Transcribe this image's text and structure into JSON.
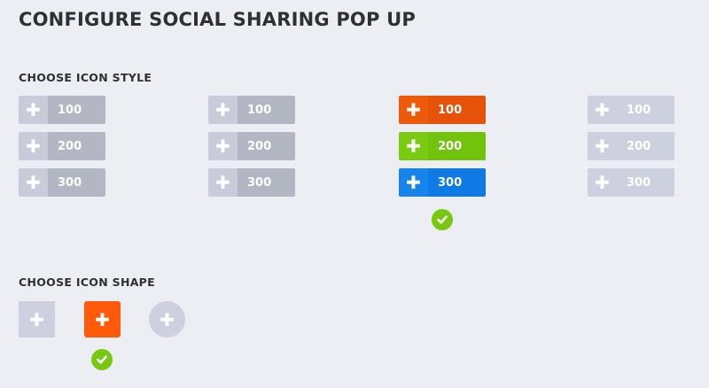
{
  "page": {
    "title": "CONFIGURE SOCIAL SHARING POP UP"
  },
  "icon_style": {
    "heading": "CHOOSE ICON STYLE",
    "plus_glyph": "✚",
    "columns": [
      {
        "variant": "gray",
        "buttons": [
          "100",
          "200",
          "300"
        ],
        "selected": false
      },
      {
        "variant": "gray",
        "buttons": [
          "100",
          "200",
          "300"
        ],
        "selected": false
      },
      {
        "variant": "colored",
        "colors": [
          "#e6520a",
          "#72c30b",
          "#0f7ae3"
        ],
        "buttons": [
          "100",
          "200",
          "300"
        ],
        "selected": true
      },
      {
        "variant": "light-gray",
        "buttons": [
          "100",
          "200",
          "300"
        ],
        "selected": false
      }
    ]
  },
  "icon_shape": {
    "heading": "CHOOSE ICON SHAPE",
    "plus_glyph": "✚",
    "shapes": [
      {
        "shape": "square",
        "color": "#cdd0de",
        "selected": false
      },
      {
        "shape": "rounded-square",
        "color": "#fe5a09",
        "selected": true
      },
      {
        "shape": "circle",
        "color": "#cdd0de",
        "selected": false
      }
    ]
  },
  "colors": {
    "selected_check": "#78c80f",
    "background": "#eceef4"
  },
  "icons": {
    "plus": "plus-icon",
    "check": "check-icon"
  }
}
